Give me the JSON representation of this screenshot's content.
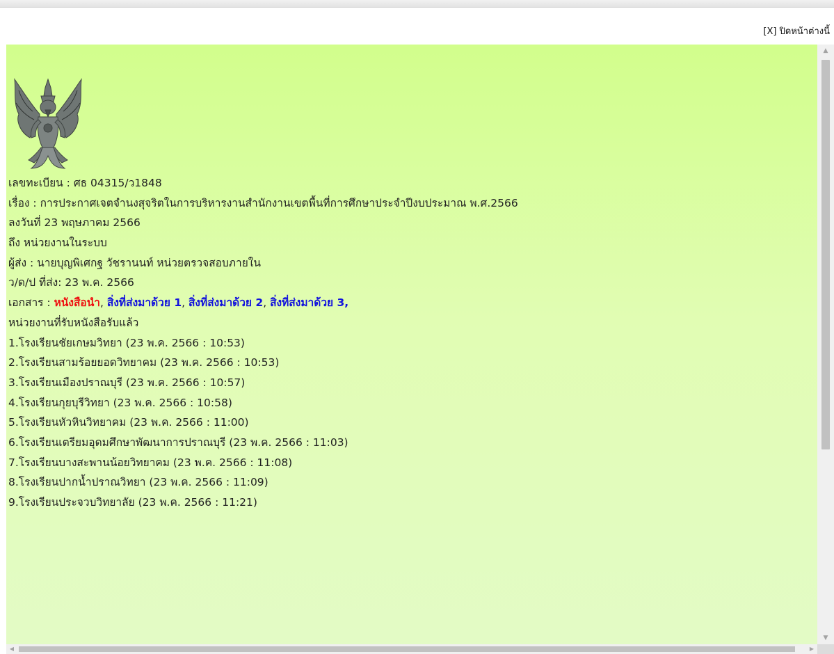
{
  "header": {
    "close_label": "[X] ปิดหน้าต่างนี้"
  },
  "document": {
    "emblem_icon": "garuda-emblem-icon",
    "registration": "เลขทะเบียน : ศธ 04315/ว1848",
    "subject": "เรื่อง : การประกาศเจตจำนงสุจริตในการบริหารงานสำนักงานเขตพื้นที่การศึกษาประจำปีงบประมาณ พ.ศ.2566",
    "dated": "ลงวันที่ 23 พฤษภาคม 2566",
    "to": "ถึง หน่วยงานในระบบ",
    "sender": "ผู้ส่ง : นายบุญพิเศกฐ วัชรานนท์ หน่วยตรวจสอบภายใน",
    "sent_date": "ว/ด/ป ที่ส่ง: 23 พ.ค. 2566",
    "attachments_label": "เอกสาร : ",
    "attachments": [
      {
        "label": "หนังสือนำ",
        "color": "#ee1111"
      },
      {
        "label": "สิ่งที่ส่งมาด้วย 1",
        "color": "#1111dd"
      },
      {
        "label": "สิ่งที่ส่งมาด้วย 2",
        "color": "#1111dd"
      },
      {
        "label": "สิ่งที่ส่งมาด้วย 3",
        "color": "#1111dd"
      }
    ],
    "received_heading": "หน่วยงานที่รับหนังสือรับแล้ว",
    "received": [
      "1.โรงเรียนชัยเกษมวิทยา (23 พ.ค. 2566 : 10:53)",
      "2.โรงเรียนสามร้อยยอดวิทยาคม (23 พ.ค. 2566 : 10:53)",
      "3.โรงเรียนเมืองปราณบุรี (23 พ.ค. 2566 : 10:57)",
      "4.โรงเรียนกุยบุรีวิทยา (23 พ.ค. 2566 : 10:58)",
      "5.โรงเรียนหัวหินวิทยาคม (23 พ.ค. 2566 : 11:00)",
      "6.โรงเรียนเตรียมอุดมศึกษาพัฒนาการปราณบุรี (23 พ.ค. 2566 : 11:03)",
      "7.โรงเรียนบางสะพานน้อยวิทยาคม (23 พ.ค. 2566 : 11:08)",
      "8.โรงเรียนปากน้ำปราณวิทยา (23 พ.ค. 2566 : 11:09)",
      "9.โรงเรียนประจวบวิทยาลัย (23 พ.ค. 2566 : 11:21)"
    ]
  },
  "colors": {
    "panel_top": "#d2fe8c",
    "panel_bottom": "#e3fbc6",
    "link_primary": "#ee1111",
    "link_secondary": "#1111dd"
  }
}
